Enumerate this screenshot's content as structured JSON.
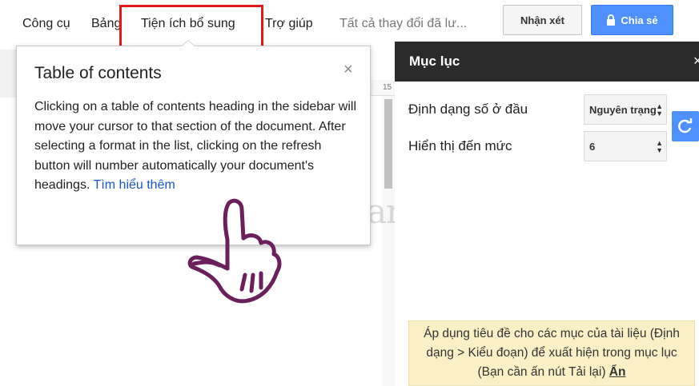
{
  "menu": {
    "items": [
      "Công cụ",
      "Bảng",
      "Tiện ích bổ sung",
      "Trợ giúp"
    ],
    "status": "Tất cả thay đổi đã lư...",
    "comment_label": "Nhận xét",
    "share_label": "Chia sẻ",
    "share_icon": "lock-icon"
  },
  "ruler": {
    "number": "15"
  },
  "tooltip": {
    "title": "Table of contents",
    "close": "×",
    "body": "Clicking on a table of contents heading in the sidebar will move your cursor to that section of the document. After selecting a format in the list, clicking on the refresh button will number automatically your document's headings. ",
    "link": "Tìm hiểu thêm"
  },
  "sidebar": {
    "title": "Mục lục",
    "close": "×",
    "numbering_label": "Định dạng số ở đầu",
    "numbering_value": "Nguyên trạng",
    "level_label": "Hiển thị đến mức",
    "level_value": "6",
    "refresh_icon": "refresh-icon",
    "note_text": "Áp dụng tiêu đề cho các mục của tài liệu (Định dạng > Kiểu đoạn) để xuất hiện trong mục lục (Bạn cần ấn nút Tải lại) ",
    "note_link": "Ẩn"
  },
  "watermark": {
    "text": "uantrimang"
  },
  "colors": {
    "accent": "#4d90fe",
    "highlight": "#e11919",
    "header_dark": "#2b2b2b",
    "note_bg": "#faf0c8",
    "link": "#1a55c9"
  }
}
